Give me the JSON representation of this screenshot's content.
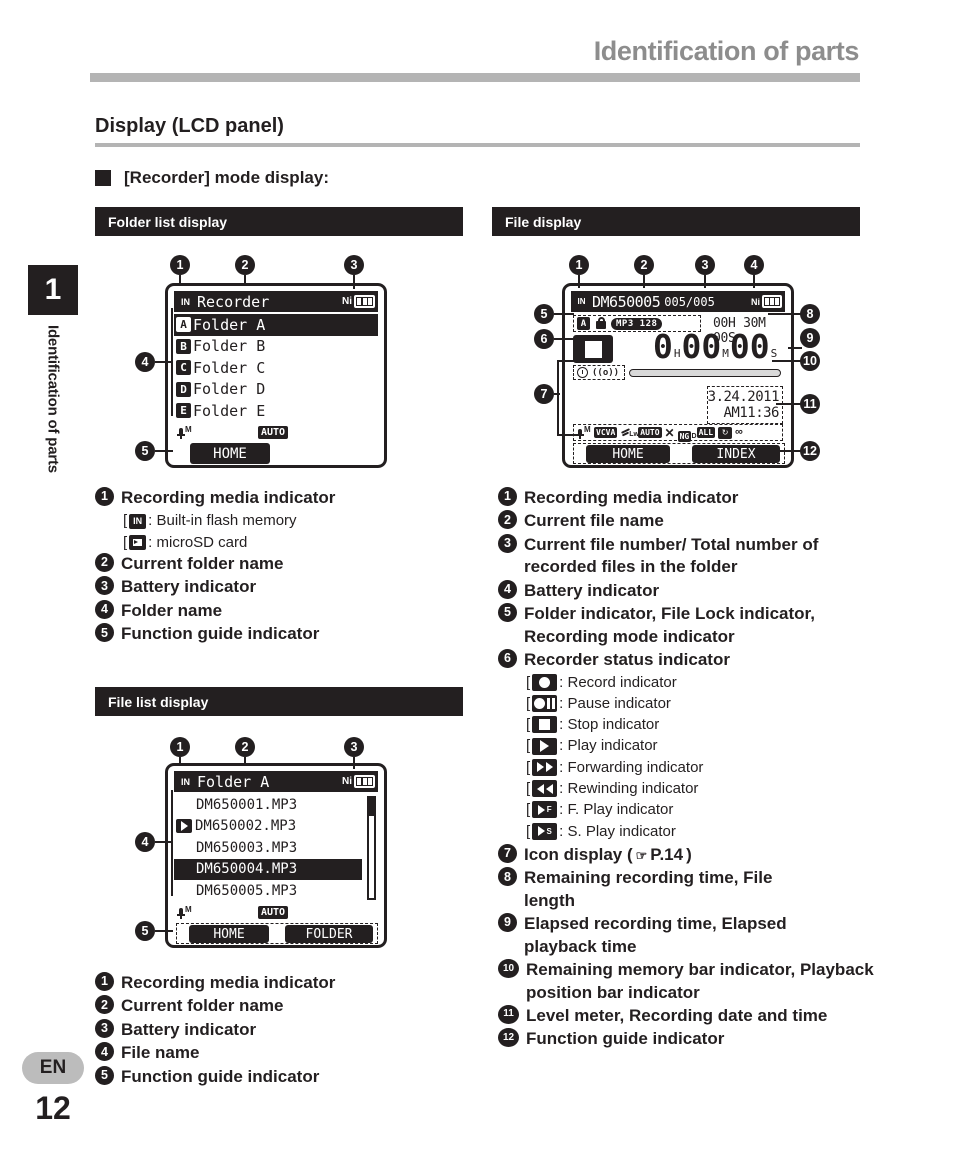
{
  "header": {
    "title": "Identification of parts"
  },
  "side": {
    "chapter_number": "1",
    "chapter_label": "Identification of parts",
    "language": "EN",
    "page_number": "12"
  },
  "section": {
    "title": "Display (LCD panel)",
    "mode_heading": "[Recorder] mode display:"
  },
  "panels": {
    "folder_list": {
      "caption": "Folder list display",
      "callouts": [
        "1",
        "2",
        "3",
        "4",
        "5"
      ],
      "header": {
        "media_icon": "in-memory-icon",
        "title": "Recorder",
        "battery_prefix": "Ni",
        "battery_icon": "battery-full-icon"
      },
      "items": [
        {
          "tag": "A",
          "label": "Folder A",
          "selected": true
        },
        {
          "tag": "B",
          "label": "Folder B",
          "selected": false
        },
        {
          "tag": "C",
          "label": "Folder C",
          "selected": false
        },
        {
          "tag": "D",
          "label": "Folder D",
          "selected": false
        },
        {
          "tag": "E",
          "label": "Folder E",
          "selected": false
        }
      ],
      "status_icons": [
        "mic-m-icon",
        "auto-badge"
      ],
      "auto_label": "AUTO",
      "guide": {
        "left": "HOME",
        "right": ""
      }
    },
    "file_list": {
      "caption": "File list display",
      "callouts": [
        "1",
        "2",
        "3",
        "4",
        "5"
      ],
      "header": {
        "media_icon": "in-memory-icon",
        "title": "Folder A",
        "battery_prefix": "Ni",
        "battery_icon": "battery-full-icon"
      },
      "items": [
        {
          "label": "DM650001.MP3",
          "playing": false,
          "selected": false
        },
        {
          "label": "DM650002.MP3",
          "playing": true,
          "selected": false
        },
        {
          "label": "DM650003.MP3",
          "playing": false,
          "selected": false
        },
        {
          "label": "DM650004.MP3",
          "playing": false,
          "selected": true
        },
        {
          "label": "DM650005.MP3",
          "playing": false,
          "selected": false
        }
      ],
      "auto_label": "AUTO",
      "guide": {
        "left": "HOME",
        "right": "FOLDER"
      }
    },
    "file_display": {
      "caption": "File display",
      "callouts": [
        "1",
        "2",
        "3",
        "4",
        "5",
        "6",
        "7",
        "8",
        "9",
        "10",
        "11",
        "12"
      ],
      "header": {
        "media_icon": "in-memory-icon",
        "file_name": "DM650005",
        "file_counter": "005/005",
        "battery_prefix": "Ni",
        "battery_icon": "battery-full-icon"
      },
      "row2": {
        "folder_tag": "A",
        "lock_icon": "file-lock-icon",
        "rec_mode": "MP3 128",
        "remaining_time": "00H 30M 00S"
      },
      "status": "stop-indicator",
      "elapsed": {
        "h": "0",
        "hu": "H",
        "m": "00",
        "mu": "M",
        "s": "00",
        "su": "S"
      },
      "bar_icons": [
        "alarm-clock-icon",
        "index-mark-icon"
      ],
      "memory_bar": "remaining-memory-bar",
      "datetime": {
        "date": "3.24.2011",
        "time": "AM11:36"
      },
      "icon_row": [
        "mic-m-icon",
        "vcva-icon",
        "low-cut-filter-icon",
        "auto-icon",
        "erase-lock-icon",
        "noise-cancel-icon",
        "all-icon",
        "repeat-icon",
        "random-icon"
      ],
      "icon_row_labels": [
        "M",
        "VCVA",
        "LOW",
        "AUTO",
        "X",
        "D",
        "ALL",
        "repeat",
        "random"
      ],
      "guide": {
        "left": "HOME",
        "right": "INDEX"
      }
    }
  },
  "legend_folder_list": [
    {
      "n": "1",
      "text": "Recording media indicator",
      "subs": [
        {
          "icon": "in-memory-icon",
          "text": ": Built-in flash memory"
        },
        {
          "icon": "microsd-icon",
          "text": ": microSD card"
        }
      ]
    },
    {
      "n": "2",
      "text": "Current folder name",
      "subs": []
    },
    {
      "n": "3",
      "text": "Battery indicator",
      "subs": []
    },
    {
      "n": "4",
      "text": "Folder name",
      "subs": []
    },
    {
      "n": "5",
      "text": "Function guide indicator",
      "subs": []
    }
  ],
  "legend_file_list": [
    {
      "n": "1",
      "text": "Recording media indicator"
    },
    {
      "n": "2",
      "text": "Current folder name"
    },
    {
      "n": "3",
      "text": "Battery indicator"
    },
    {
      "n": "4",
      "text": "File name"
    },
    {
      "n": "5",
      "text": "Function guide indicator"
    }
  ],
  "legend_file_display": [
    {
      "n": "1",
      "text": "Recording media indicator",
      "subs": []
    },
    {
      "n": "2",
      "text": "Current file name",
      "subs": []
    },
    {
      "n": "3",
      "text": "Current file number/ Total number of recorded files in the folder",
      "subs": []
    },
    {
      "n": "4",
      "text": "Battery indicator",
      "subs": []
    },
    {
      "n": "5",
      "text": "Folder indicator, File Lock indicator, Recording mode indicator",
      "subs": []
    },
    {
      "n": "6",
      "text": "Recorder status indicator",
      "subs": [
        {
          "icon": "record-indicator-icon",
          "text": ": Record indicator"
        },
        {
          "icon": "pause-indicator-icon",
          "text": ": Pause indicator"
        },
        {
          "icon": "stop-indicator-icon",
          "text": ": Stop indicator"
        },
        {
          "icon": "play-indicator-icon",
          "text": ": Play indicator"
        },
        {
          "icon": "forward-indicator-icon",
          "text": ": Forwarding indicator"
        },
        {
          "icon": "rewind-indicator-icon",
          "text": ": Rewinding indicator"
        },
        {
          "icon": "fast-play-indicator-icon",
          "text": ": F. Play indicator"
        },
        {
          "icon": "slow-play-indicator-icon",
          "text": ": S. Play indicator"
        }
      ]
    },
    {
      "n": "7",
      "text": "Icon display (",
      "ref": "P.14",
      "suffix": ")",
      "subs": []
    },
    {
      "n": "8",
      "text": "Remaining recording time, File length",
      "subs": []
    },
    {
      "n": "9",
      "text": "Elapsed recording time, Elapsed playback time",
      "subs": []
    },
    {
      "n": "10",
      "text": "Remaining memory bar indicator, Playback position bar indicator",
      "subs": []
    },
    {
      "n": "11",
      "text": "Level meter, Recording date and time",
      "subs": []
    },
    {
      "n": "12",
      "text": "Function guide indicator",
      "subs": []
    }
  ],
  "colors": {
    "ink": "#231f20",
    "rule": "#b4b4b4",
    "header_title": "#8d8d8d",
    "pill": "#bcbcbc"
  }
}
